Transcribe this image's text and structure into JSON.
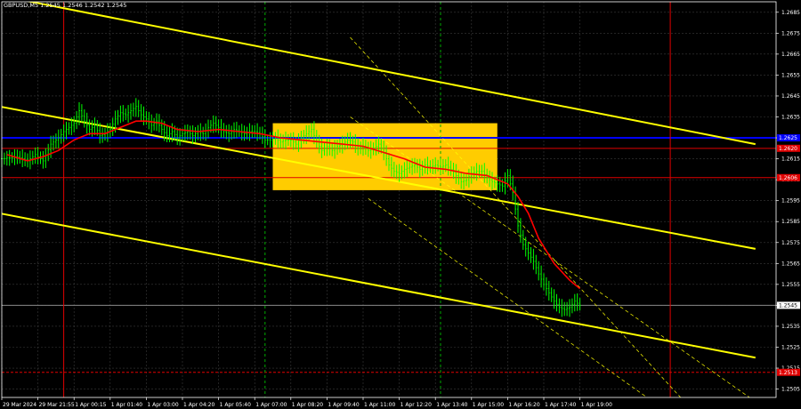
{
  "chart_data": {
    "type": "line",
    "symbol_title": "GBPUSD,M5  1.2545 1.2546 1.2542 1.2545",
    "ylim": [
      1.2501,
      1.269
    ],
    "y_ticks": [
      1.2685,
      1.2675,
      1.2665,
      1.2655,
      1.2645,
      1.2635,
      1.2625,
      1.2615,
      1.2605,
      1.2595,
      1.2585,
      1.2575,
      1.2565,
      1.2555,
      1.2545,
      1.2535,
      1.2525,
      1.2515,
      1.2505
    ],
    "y_tick_labels": [
      "1.2685",
      "1.2675",
      "1.2665",
      "1.2655",
      "1.2645",
      "1.2635",
      "1.2625",
      "1.2615",
      "1.2605",
      "1.2595",
      "1.2585",
      "1.2575",
      "1.2565",
      "1.2555",
      "1.2545",
      "1.2535",
      "1.2525",
      "1.2515",
      "1.2505"
    ],
    "bar_count": 220,
    "x_labels": [
      {
        "bar": 0,
        "text": "29 Mar 2024"
      },
      {
        "bar": 14,
        "text": "29 Mar 21:55"
      },
      {
        "bar": 28,
        "text": "1 Apr 00:15"
      },
      {
        "bar": 42,
        "text": "1 Apr 01:40"
      },
      {
        "bar": 56,
        "text": "1 Apr 03:00"
      },
      {
        "bar": 70,
        "text": "1 Apr 04:20"
      },
      {
        "bar": 84,
        "text": "1 Apr 05:40"
      },
      {
        "bar": 98,
        "text": "1 Apr 07:00"
      },
      {
        "bar": 112,
        "text": "1 Apr 08:20"
      },
      {
        "bar": 126,
        "text": "1 Apr 09:40"
      },
      {
        "bar": 140,
        "text": "1 Apr 11:00"
      },
      {
        "bar": 154,
        "text": "1 Apr 12:20"
      },
      {
        "bar": 168,
        "text": "1 Apr 13:40"
      },
      {
        "bar": 182,
        "text": "1 Apr 15:00"
      },
      {
        "bar": 196,
        "text": "1 Apr 16:20"
      },
      {
        "bar": 210,
        "text": "1 Apr 17:40"
      },
      {
        "bar": 224,
        "text": "1 Apr 19:00"
      }
    ],
    "price_keypoints": [
      [
        0,
        1.2615
      ],
      [
        6,
        1.2616
      ],
      [
        10,
        1.2614
      ],
      [
        13,
        1.2617
      ],
      [
        16,
        1.2614
      ],
      [
        19,
        1.2622
      ],
      [
        22,
        1.2625
      ],
      [
        24,
        1.2628
      ],
      [
        26,
        1.263
      ],
      [
        28,
        1.2632
      ],
      [
        30,
        1.2638
      ],
      [
        32,
        1.2633
      ],
      [
        34,
        1.2629
      ],
      [
        36,
        1.2631
      ],
      [
        38,
        1.2626
      ],
      [
        40,
        1.2627
      ],
      [
        42,
        1.2629
      ],
      [
        44,
        1.2634
      ],
      [
        46,
        1.2637
      ],
      [
        48,
        1.2636
      ],
      [
        50,
        1.2638
      ],
      [
        52,
        1.264
      ],
      [
        54,
        1.2636
      ],
      [
        56,
        1.2634
      ],
      [
        58,
        1.2631
      ],
      [
        60,
        1.2633
      ],
      [
        62,
        1.2629
      ],
      [
        64,
        1.2626
      ],
      [
        66,
        1.2628
      ],
      [
        68,
        1.2625
      ],
      [
        70,
        1.2627
      ],
      [
        72,
        1.2628
      ],
      [
        74,
        1.2626
      ],
      [
        76,
        1.2628
      ],
      [
        78,
        1.2627
      ],
      [
        80,
        1.263
      ],
      [
        82,
        1.2632
      ],
      [
        84,
        1.263
      ],
      [
        86,
        1.2628
      ],
      [
        88,
        1.2627
      ],
      [
        90,
        1.2629
      ],
      [
        92,
        1.2628
      ],
      [
        94,
        1.2627
      ],
      [
        96,
        1.2628
      ],
      [
        98,
        1.2628
      ],
      [
        100,
        1.2627
      ],
      [
        102,
        1.2624
      ],
      [
        104,
        1.2624
      ],
      [
        106,
        1.2625
      ],
      [
        108,
        1.2623
      ],
      [
        110,
        1.2624
      ],
      [
        112,
        1.2624
      ],
      [
        114,
        1.2622
      ],
      [
        116,
        1.2625
      ],
      [
        118,
        1.2627
      ],
      [
        120,
        1.2629
      ],
      [
        122,
        1.2623
      ],
      [
        124,
        1.2619
      ],
      [
        126,
        1.2621
      ],
      [
        128,
        1.2619
      ],
      [
        130,
        1.2621
      ],
      [
        132,
        1.2622
      ],
      [
        134,
        1.2624
      ],
      [
        136,
        1.2623
      ],
      [
        138,
        1.262
      ],
      [
        140,
        1.2621
      ],
      [
        142,
        1.2619
      ],
      [
        144,
        1.262
      ],
      [
        146,
        1.2622
      ],
      [
        148,
        1.2618
      ],
      [
        150,
        1.2612
      ],
      [
        152,
        1.2609
      ],
      [
        154,
        1.2608
      ],
      [
        156,
        1.261
      ],
      [
        158,
        1.2611
      ],
      [
        160,
        1.2612
      ],
      [
        162,
        1.261
      ],
      [
        164,
        1.2612
      ],
      [
        166,
        1.2611
      ],
      [
        168,
        1.2612
      ],
      [
        170,
        1.2611
      ],
      [
        172,
        1.2612
      ],
      [
        174,
        1.261
      ],
      [
        176,
        1.2607
      ],
      [
        178,
        1.2604
      ],
      [
        180,
        1.2605
      ],
      [
        182,
        1.2608
      ],
      [
        184,
        1.2609
      ],
      [
        186,
        1.2609
      ],
      [
        188,
        1.2606
      ],
      [
        190,
        1.2604
      ],
      [
        192,
        1.2603
      ],
      [
        194,
        1.2602
      ],
      [
        196,
        1.2607
      ],
      [
        198,
        1.2599
      ],
      [
        200,
        1.2583
      ],
      [
        202,
        1.2574
      ],
      [
        204,
        1.257
      ],
      [
        206,
        1.2566
      ],
      [
        208,
        1.256
      ],
      [
        210,
        1.2555
      ],
      [
        212,
        1.2551
      ],
      [
        214,
        1.2547
      ],
      [
        216,
        1.2544
      ],
      [
        218,
        1.2543
      ],
      [
        220,
        1.2544
      ],
      [
        222,
        1.2547
      ],
      [
        224,
        1.2545
      ]
    ],
    "ma_keypoints": [
      [
        2,
        1.2617
      ],
      [
        10,
        1.2614
      ],
      [
        16,
        1.2616
      ],
      [
        22,
        1.2619
      ],
      [
        28,
        1.2624
      ],
      [
        34,
        1.2627
      ],
      [
        40,
        1.2627
      ],
      [
        46,
        1.263
      ],
      [
        52,
        1.2633
      ],
      [
        56,
        1.2633
      ],
      [
        62,
        1.2632
      ],
      [
        68,
        1.2629
      ],
      [
        76,
        1.2628
      ],
      [
        84,
        1.2629
      ],
      [
        92,
        1.2628
      ],
      [
        100,
        1.2627
      ],
      [
        108,
        1.2625
      ],
      [
        116,
        1.2624
      ],
      [
        124,
        1.2623
      ],
      [
        132,
        1.2622
      ],
      [
        140,
        1.2621
      ],
      [
        148,
        1.2618
      ],
      [
        156,
        1.2615
      ],
      [
        164,
        1.2611
      ],
      [
        172,
        1.261
      ],
      [
        180,
        1.2608
      ],
      [
        188,
        1.2607
      ],
      [
        196,
        1.2603
      ],
      [
        200,
        1.2597
      ],
      [
        204,
        1.2589
      ],
      [
        208,
        1.2577
      ],
      [
        214,
        1.2565
      ],
      [
        220,
        1.2557
      ],
      [
        224,
        1.2553
      ]
    ],
    "trend_lines": [
      {
        "from": [
          -1,
          1.2693
        ],
        "to": [
          292,
          1.2622
        ],
        "color": "#ffff00"
      },
      {
        "from": [
          -1,
          1.264
        ],
        "to": [
          292,
          1.2572
        ],
        "color": "#ffff00"
      },
      {
        "from": [
          -1,
          1.2589
        ],
        "to": [
          292,
          1.252
        ],
        "color": "#ffff00"
      },
      {
        "from": [
          135,
          1.2673
        ],
        "to": [
          263,
          1.2501
        ],
        "color": "#ffff00",
        "dashed": true
      },
      {
        "from": [
          135,
          1.2635
        ],
        "to": [
          292,
          1.2499
        ],
        "color": "#ffff00",
        "dashed": true
      },
      {
        "from": [
          142,
          1.2596
        ],
        "to": [
          250,
          1.2501
        ],
        "color": "#ffff00",
        "dashed": true
      }
    ],
    "horizontal_levels": [
      {
        "value": 1.2625,
        "color": "#0000ff",
        "label": "1.2625"
      },
      {
        "value": 1.262,
        "color": "#e00000",
        "label": "1.2620"
      },
      {
        "value": 1.2606,
        "color": "#e00000",
        "label": "1.2606"
      },
      {
        "value": 1.2545,
        "color": "#888888",
        "label": "1.2545"
      },
      {
        "value": 1.2513,
        "color": "#e00000",
        "label": "1.2513",
        "dashed": true
      }
    ],
    "vertical_lines": [
      {
        "bar": 24,
        "color": "#e00000"
      },
      {
        "bar": 102,
        "color": "#00aa00",
        "dashed": true
      },
      {
        "bar": 170,
        "color": "#00aa00",
        "dashed": true
      },
      {
        "bar": 259,
        "color": "#e00000"
      }
    ],
    "rect_zone": {
      "from_bar": 105,
      "to_bar": 192,
      "top": 1.2632,
      "bottom": 1.26,
      "color": "#ffcc00"
    },
    "colors": {
      "background": "#000000",
      "price": "#00ff00",
      "ma": "#ff0000",
      "grid": "#3a3a3a",
      "axis_text": "#ffffff"
    }
  }
}
